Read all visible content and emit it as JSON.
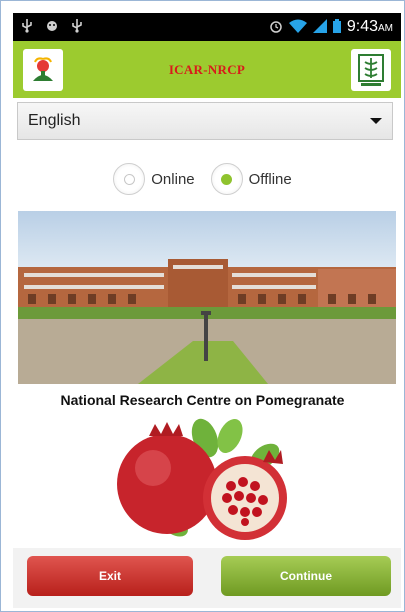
{
  "status_bar": {
    "time": "9:43",
    "ampm": "AM"
  },
  "header": {
    "title": "ICAR-NRCP"
  },
  "language_select": {
    "selected": "English"
  },
  "mode": {
    "options": [
      "Online",
      "Offline"
    ],
    "selected": "Offline"
  },
  "centre_name": "National Research Centre on Pomegranate",
  "buttons": {
    "exit": "Exit",
    "continue": "Continue"
  },
  "colors": {
    "appbar": "#9ccb2f",
    "title": "#d81b1b",
    "exit": "#c8312b",
    "continue": "#8ab83a"
  }
}
